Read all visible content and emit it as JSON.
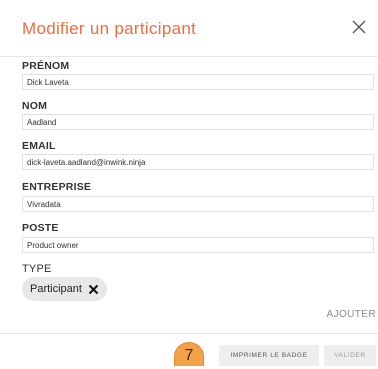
{
  "modal": {
    "title": "Modifier un participant",
    "close_icon": "close-icon"
  },
  "fields": [
    {
      "label": "PRÉNOM",
      "value": "Dick Laveta"
    },
    {
      "label": "NOM",
      "value": "Aadland"
    },
    {
      "label": "EMAIL",
      "value": "dick-laveta.aadland@inwink.ninja"
    },
    {
      "label": "ENTREPRISE",
      "value": "Vivradata"
    },
    {
      "label": "POSTE",
      "value": "Product owner"
    }
  ],
  "type": {
    "label": "TYPE",
    "chip": "Participant",
    "chip_remove_icon": "close-icon"
  },
  "ajouter_label": "AJOUTER",
  "step_badge": "7",
  "buttons": {
    "print_badge": "IMPRIMER LE BADGE",
    "validate": "VALIDER"
  },
  "colors": {
    "title": "#ef6c3b",
    "badge": "#f4a24a"
  }
}
